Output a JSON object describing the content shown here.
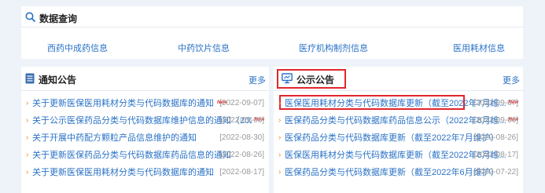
{
  "query": {
    "title": "数据查询",
    "links": [
      "西药中成药信息",
      "中药饮片信息",
      "医疗机构制剂信息",
      "医用耗材信息"
    ]
  },
  "notice": {
    "title": "通知公告",
    "more": "更多",
    "items": [
      {
        "title": "关于更新医保医用耗材分类与代码数据库的通知",
        "new": "New",
        "date": "[2022-09-07]"
      },
      {
        "title": "关于公示医保药品分类与代码数据库维护信息的通知（202...",
        "new": "New",
        "date": "[2022-09-06]"
      },
      {
        "title": "关于开展中药配方颗粒产品信息维护的通知",
        "new": "",
        "date": "[2022-08-30]"
      },
      {
        "title": "关于更新医保药品分类与代码数据库药品信息的通知",
        "new": "",
        "date": "[2022-08-26]"
      },
      {
        "title": "关于更新医保医用耗材分类与代码数据库的通知",
        "new": "",
        "date": "[2022-08-17]"
      }
    ]
  },
  "public": {
    "title": "公示公告",
    "more": "更多",
    "items": [
      {
        "title": "医保医用耗材分类与代码数据库更新（截至2022年7月维...",
        "new": "New",
        "date": "[2022-09-07]"
      },
      {
        "title": "医保药品分类与代码数据库药品信息公示（2022年8月维...",
        "new": "New",
        "date": "[2022-09-06]"
      },
      {
        "title": "医保药品分类与代码数据库更新（截至2022年7月维护）",
        "new": "",
        "date": "[2022-08-26]"
      },
      {
        "title": "医保医用耗材分类与代码数据库更新（截至2022年6月维...",
        "new": "",
        "date": "[2022-08-17]"
      },
      {
        "title": "医保药品分类与代码数据库更新（截至2022年6月维护）",
        "new": "",
        "date": "[2022-07-22]"
      }
    ]
  },
  "colors": {
    "link": "#2a72c6",
    "bullet": "#f08b1b",
    "highlight": "#e0262d",
    "date": "#999999"
  },
  "icons": {
    "query": "search-icon",
    "notice": "document-list-icon",
    "public": "monitor-icon"
  }
}
